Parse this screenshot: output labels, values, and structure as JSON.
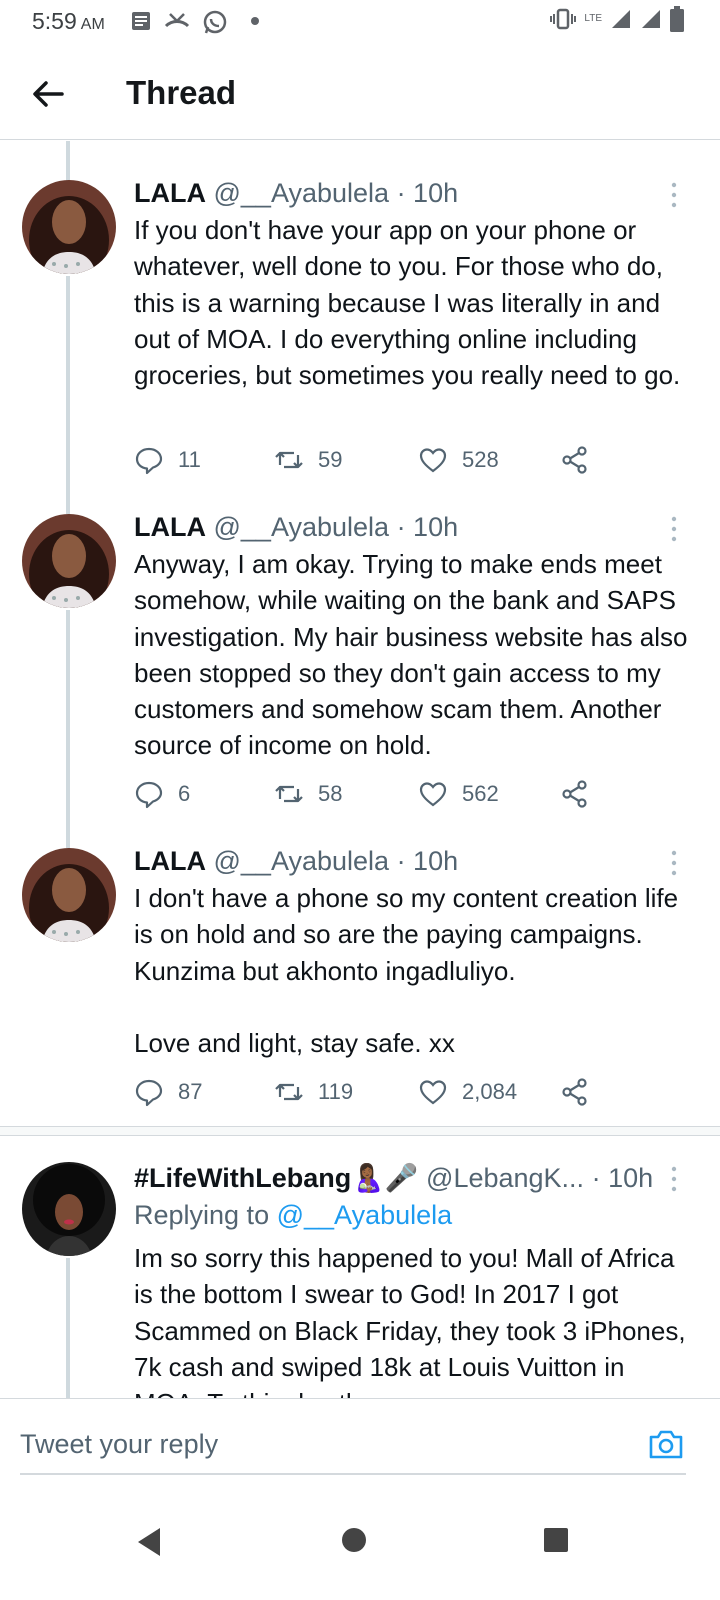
{
  "status_bar": {
    "time": "5:59",
    "ampm": "AM",
    "network": "LTE"
  },
  "header": {
    "title": "Thread",
    "back_icon": "arrow-left-icon"
  },
  "tweets": [
    {
      "name": "LALA",
      "handle": "@__Ayabulela",
      "time": "· 10h",
      "text": "If you don't have your app on your phone or whatever, well done to you. For those who do, this is a warning because I was literally in and out of MOA. I do everything online including groceries, but sometimes you really need to go.",
      "replies": "11",
      "retweets": "59",
      "likes": "528"
    },
    {
      "name": "LALA",
      "handle": "@__Ayabulela",
      "time": "· 10h",
      "text": "Anyway, I am okay. Trying to make ends meet somehow, while waiting on the bank and SAPS investigation. My hair business website has also been stopped so they don't gain access to my customers and somehow scam them. Another source of income on hold.",
      "replies": "6",
      "retweets": "58",
      "likes": "562"
    },
    {
      "name": "LALA",
      "handle": "@__Ayabulela",
      "time": "· 10h",
      "text": "I don't have a phone so my content creation life is on hold and so are the paying campaigns. Kunzima but akhonto ingadluliyo.\n\nLove and light, stay safe. xx",
      "replies": "87",
      "retweets": "119",
      "likes": "2,084"
    }
  ],
  "reply_tweet": {
    "name": "#LifeWithLebang",
    "emoji": "🤱🏾🎤",
    "handle": "@LebangK...",
    "time": "· 10h",
    "replying_label": "Replying to",
    "replying_handle": "@__Ayabulela",
    "text": "Im so sorry this happened to you! Mall of Africa is the bottom I swear to God! In 2017 I got Scammed on Black Friday, they took 3 iPhones, 7k cash and swiped 18k at Louis Vuitton in MOA. To this day th"
  },
  "reply_bar": {
    "placeholder": "Tweet your reply"
  },
  "colors": {
    "accent": "#1d9bf0",
    "text": "#0f1419",
    "secondary": "#536471",
    "divider": "#d4d9dd"
  }
}
